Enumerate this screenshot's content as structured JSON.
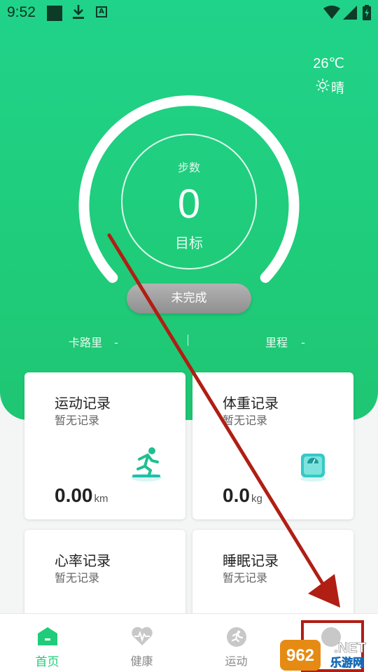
{
  "status_bar": {
    "time": "9:52",
    "a_icon_letter": "A"
  },
  "weather": {
    "temperature": "26℃",
    "condition": "晴",
    "icon": "sun-icon"
  },
  "steps": {
    "label": "步数",
    "value": "0",
    "goal_label": "目标"
  },
  "completion_button": {
    "label": "未完成"
  },
  "stats": {
    "calories_label": "卡路里",
    "calories_value": "-",
    "separator": "|",
    "distance_label": "里程",
    "distance_value": "-"
  },
  "cards": {
    "exercise": {
      "title": "运动记录",
      "subtitle": "暂无记录",
      "value": "0.00",
      "unit": "km",
      "icon": "running-icon"
    },
    "weight": {
      "title": "体重记录",
      "subtitle": "暂无记录",
      "value": "0.0",
      "unit": "kg",
      "icon": "scale-icon"
    },
    "heart_rate": {
      "title": "心率记录",
      "subtitle": "暂无记录"
    },
    "sleep": {
      "title": "睡眠记录",
      "subtitle": "暂无记录"
    }
  },
  "bottom_nav": {
    "items": [
      {
        "label": "首页",
        "icon": "home-icon",
        "active": true
      },
      {
        "label": "健康",
        "icon": "heart-icon",
        "active": false
      },
      {
        "label": "运动",
        "icon": "run-icon",
        "active": false
      },
      {
        "label": "",
        "icon": "profile-icon",
        "active": false
      }
    ]
  },
  "watermark": {
    "text_top": "962.NET",
    "text_bottom": "乐游网"
  },
  "colors": {
    "primary_green": "#1fcc7a",
    "annotation_red": "#b01e14",
    "button_gray": "#9e9e9e"
  }
}
